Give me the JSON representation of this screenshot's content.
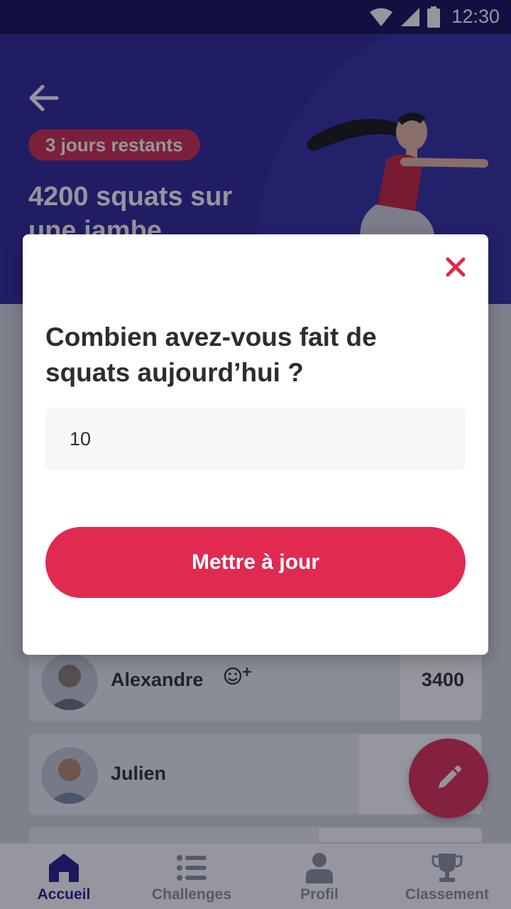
{
  "status_bar": {
    "time": "12:30",
    "icons": [
      "wifi-icon",
      "signal-icon",
      "battery-icon"
    ]
  },
  "header": {
    "badge": "3 jours restants",
    "title": "4200 squats sur une jambe"
  },
  "participants": [
    {
      "name": "Alexandre",
      "score": "3400",
      "progress": 0.82,
      "has_reaction": true
    },
    {
      "name": "Julien",
      "score": "",
      "progress": 0.73,
      "has_reaction": false
    }
  ],
  "dialog": {
    "question": "Combien avez-vous fait de squats aujourd’hui ?",
    "input_value": "10",
    "submit_label": "Mettre à jour"
  },
  "bottom_nav": {
    "items": [
      {
        "label": "Accueil",
        "icon": "home-icon",
        "active": true
      },
      {
        "label": "Challenges",
        "icon": "list-icon",
        "active": false
      },
      {
        "label": "Profil",
        "icon": "profile-icon",
        "active": false
      },
      {
        "label": "Classement",
        "icon": "trophy-icon",
        "active": false
      }
    ]
  },
  "colors": {
    "primary": "#e02a50",
    "header_bg": "#2c2496",
    "nav_active": "#241b8a"
  }
}
